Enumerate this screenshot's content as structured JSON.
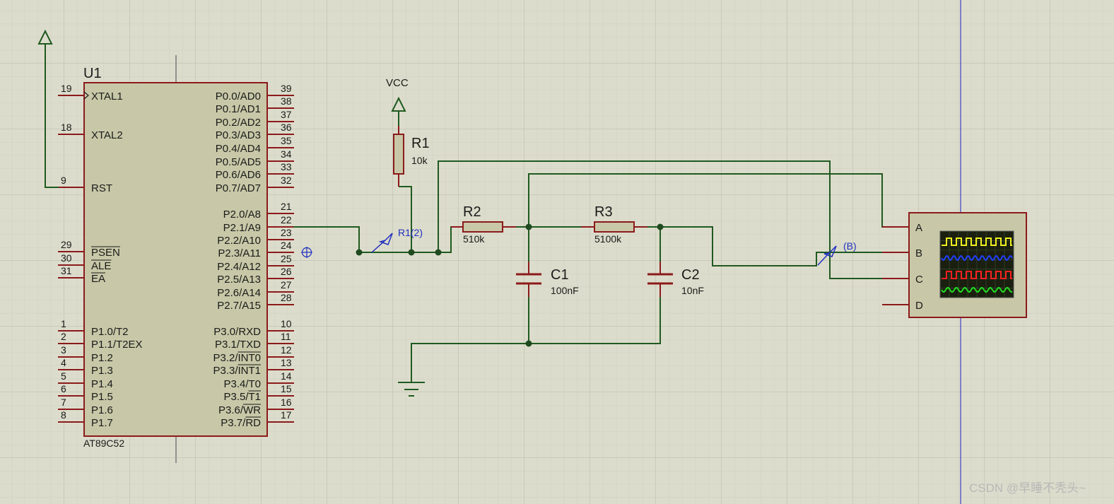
{
  "u1": {
    "ref": "U1",
    "part": "AT89C52",
    "left_pins": [
      {
        "num": "19",
        "label": "XTAL1",
        "over": false
      },
      {
        "num": "18",
        "label": "XTAL2",
        "over": false
      },
      {
        "num": "9",
        "label": "RST",
        "over": false
      },
      {
        "num": "29",
        "label": "PSEN",
        "over": true
      },
      {
        "num": "30",
        "label": "ALE",
        "over": true
      },
      {
        "num": "31",
        "label": "EA",
        "over": true
      },
      {
        "num": "1",
        "label": "P1.0/T2",
        "over": false
      },
      {
        "num": "2",
        "label": "P1.1/T2EX",
        "over": false
      },
      {
        "num": "3",
        "label": "P1.2",
        "over": false
      },
      {
        "num": "4",
        "label": "P1.3",
        "over": false
      },
      {
        "num": "5",
        "label": "P1.4",
        "over": false
      },
      {
        "num": "6",
        "label": "P1.5",
        "over": false
      },
      {
        "num": "7",
        "label": "P1.6",
        "over": false
      },
      {
        "num": "8",
        "label": "P1.7",
        "over": false
      }
    ],
    "right_pins": [
      {
        "num": "39",
        "label": "P0.0/AD0",
        "over": ""
      },
      {
        "num": "38",
        "label": "P0.1/AD1",
        "over": ""
      },
      {
        "num": "37",
        "label": "P0.2/AD2",
        "over": ""
      },
      {
        "num": "36",
        "label": "P0.3/AD3",
        "over": ""
      },
      {
        "num": "35",
        "label": "P0.4/AD4",
        "over": ""
      },
      {
        "num": "34",
        "label": "P0.5/AD5",
        "over": ""
      },
      {
        "num": "33",
        "label": "P0.6/AD6",
        "over": ""
      },
      {
        "num": "32",
        "label": "P0.7/AD7",
        "over": ""
      },
      {
        "num": "21",
        "label": "P2.0/A8",
        "over": ""
      },
      {
        "num": "22",
        "label": "P2.1/A9",
        "over": ""
      },
      {
        "num": "23",
        "label": "P2.2/A10",
        "over": ""
      },
      {
        "num": "24",
        "label": "P2.3/A11",
        "over": ""
      },
      {
        "num": "25",
        "label": "P2.4/A12",
        "over": ""
      },
      {
        "num": "26",
        "label": "P2.5/A13",
        "over": ""
      },
      {
        "num": "27",
        "label": "P2.6/A14",
        "over": ""
      },
      {
        "num": "28",
        "label": "P2.7/A15",
        "over": ""
      },
      {
        "num": "10",
        "label": "P3.0/RXD",
        "over": ""
      },
      {
        "num": "11",
        "label": "P3.1/TXD",
        "over": ""
      },
      {
        "num": "12",
        "label": "P3.2/INT0",
        "over": "INT0"
      },
      {
        "num": "13",
        "label": "P3.3/INT1",
        "over": "INT1"
      },
      {
        "num": "14",
        "label": "P3.4/T0",
        "over": ""
      },
      {
        "num": "15",
        "label": "P3.5/T1",
        "over": "T1"
      },
      {
        "num": "16",
        "label": "P3.6/WR",
        "over": "WR"
      },
      {
        "num": "17",
        "label": "P3.7/RD",
        "over": "RD"
      }
    ]
  },
  "vcc_label": "VCC",
  "r1": {
    "ref": "R1",
    "value": "10k"
  },
  "r2": {
    "ref": "R2",
    "value": "510k"
  },
  "r3": {
    "ref": "R3",
    "value": "5100k"
  },
  "c1": {
    "ref": "C1",
    "value": "100nF"
  },
  "c2": {
    "ref": "C2",
    "value": "10nF"
  },
  "probe1": "R1(2)",
  "probe2": "(B)",
  "scope": {
    "channels": [
      "A",
      "B",
      "C",
      "D"
    ],
    "trace_colors": [
      "#f0f020",
      "#2040ff",
      "#ff2020",
      "#20e020"
    ]
  },
  "watermark": "CSDN @早睡不秃头~"
}
